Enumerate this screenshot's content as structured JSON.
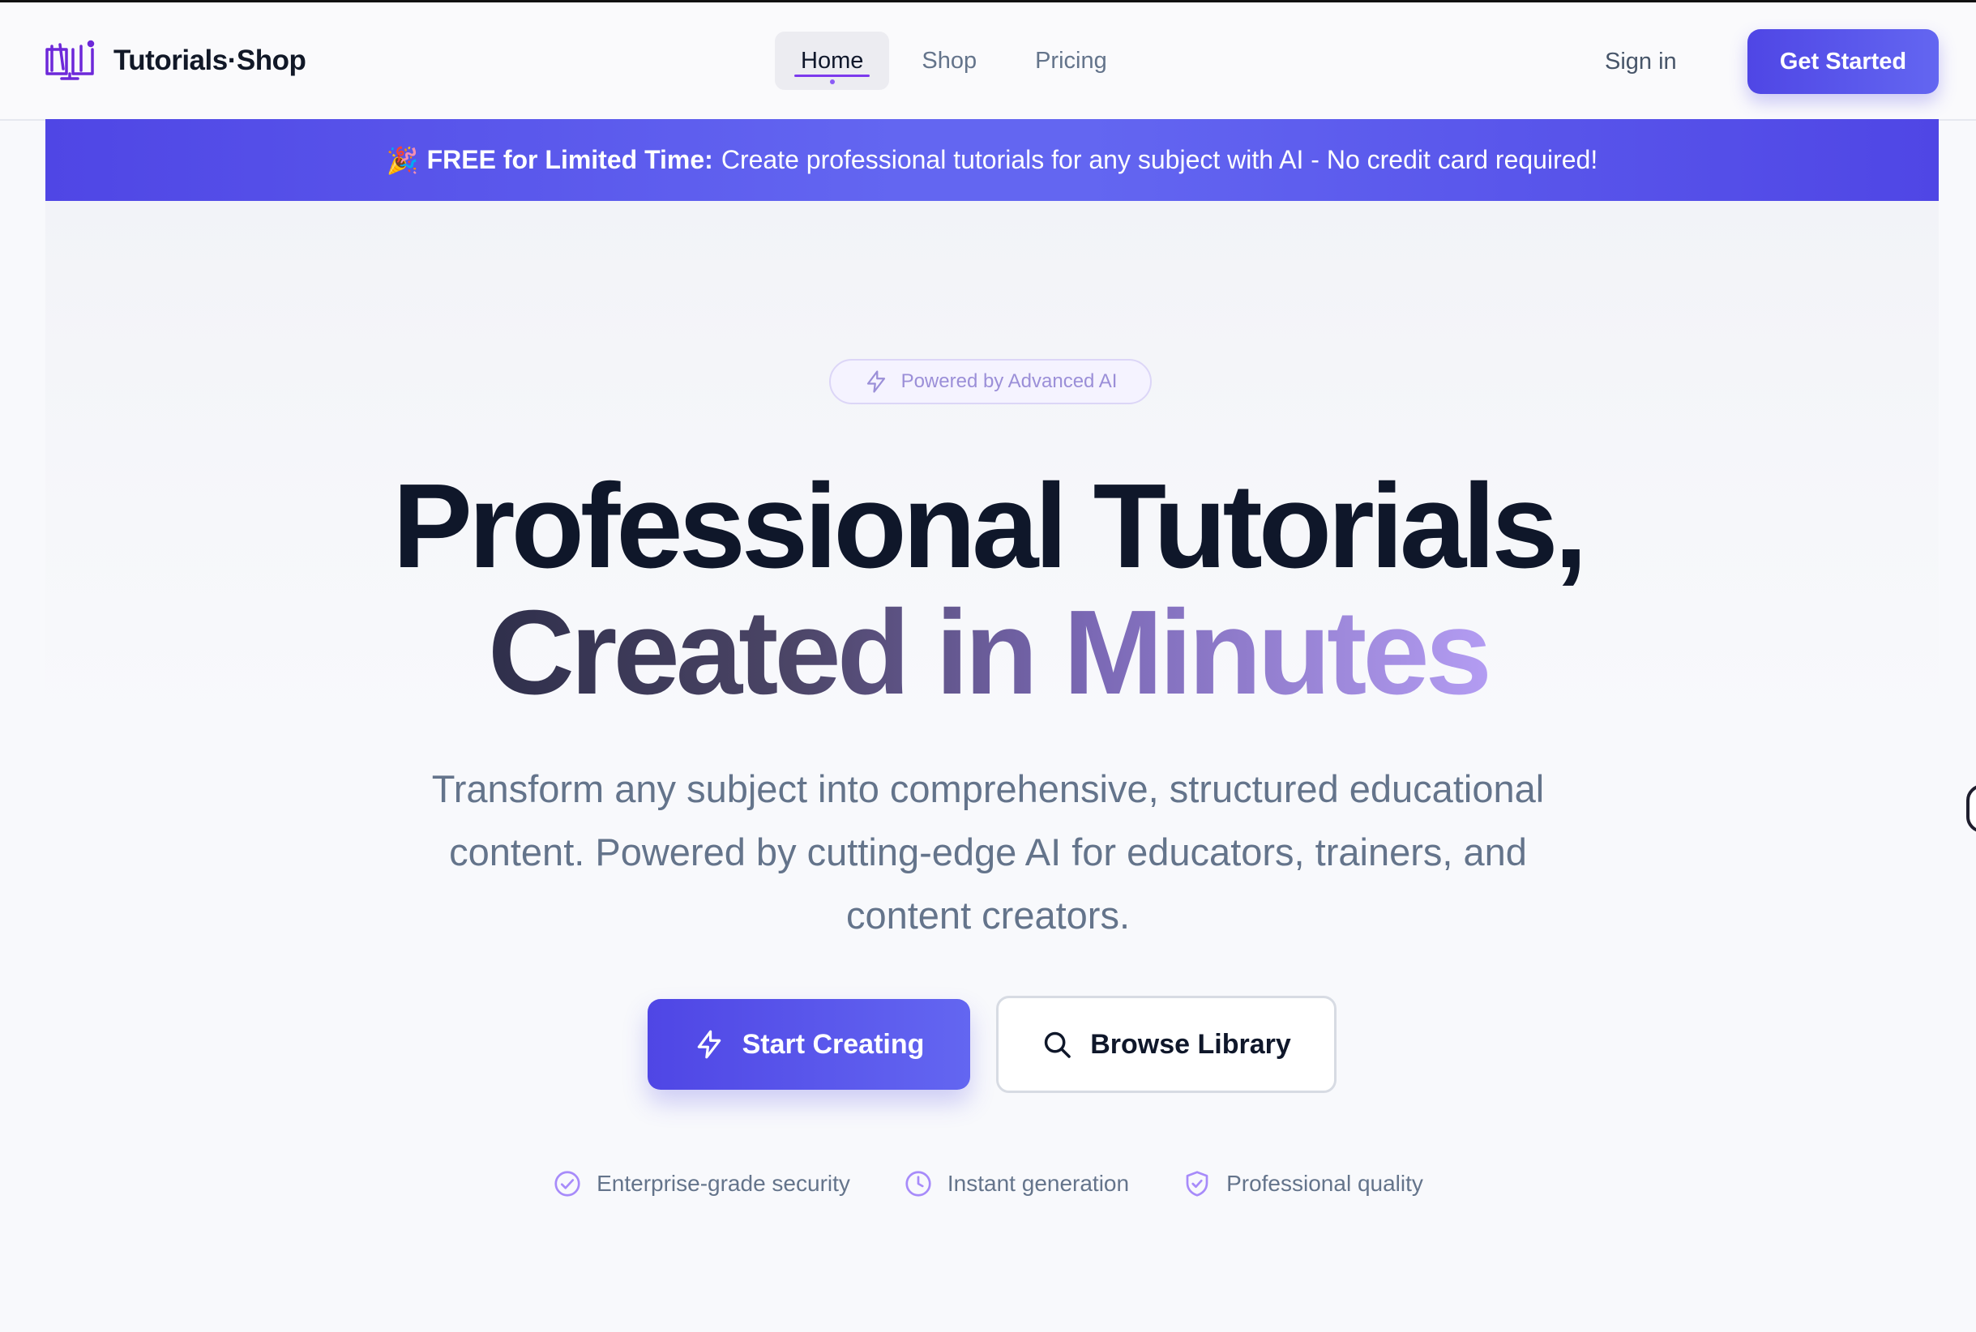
{
  "brand": {
    "name": "Tutorials·Shop",
    "icon": "book-screen-icon",
    "color": "#6d28d9"
  },
  "nav": {
    "items": [
      {
        "label": "Home",
        "active": true
      },
      {
        "label": "Shop",
        "active": false
      },
      {
        "label": "Pricing",
        "active": false
      }
    ],
    "signin_label": "Sign in",
    "cta_label": "Get Started"
  },
  "promo": {
    "emoji": "🎉",
    "bold": "FREE for Limited Time:",
    "text": "Create professional tutorials for any subject with AI - No credit card required!"
  },
  "hero": {
    "badge": "Powered by Advanced AI",
    "title_line1": "Professional Tutorials,",
    "title_line2": "Created in Minutes",
    "subtitle": "Transform any subject into comprehensive, structured educational content. Powered by cutting-edge AI for educators, trainers, and content creators.",
    "primary_button": "Start Creating",
    "secondary_button": "Browse Library"
  },
  "features": [
    {
      "icon": "check-circle-icon",
      "label": "Enterprise-grade security"
    },
    {
      "icon": "clock-icon",
      "label": "Instant generation"
    },
    {
      "icon": "shield-check-icon",
      "label": "Professional quality"
    }
  ],
  "colors": {
    "accent": "#4f46e5",
    "accent_light": "#6366f1",
    "muted_purple": "#9b8fd8"
  }
}
